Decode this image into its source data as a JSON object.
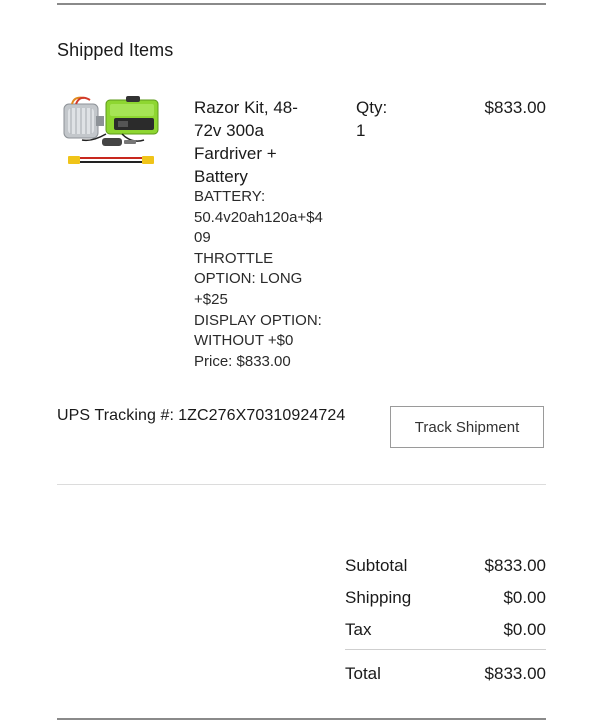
{
  "section_title": "Shipped Items",
  "item": {
    "image_alt": "Razor Kit product photo",
    "name_lines": [
      "Razor Kit, 48-",
      "72v 300a",
      "Fardriver +",
      "Battery"
    ],
    "option_lines": [
      "BATTERY:",
      "50.4v20ah120a+$4",
      "09",
      "THROTTLE",
      "OPTION: LONG",
      "+$25",
      "DISPLAY OPTION:",
      "WITHOUT +$0",
      "Price: $833.00"
    ],
    "qty_label": "Qty:",
    "qty_value": "1",
    "line_price": "$833.00"
  },
  "tracking": {
    "label": "UPS Tracking #:",
    "number": "1ZC276X70310924724",
    "button_label": "Track Shipment"
  },
  "summary": {
    "subtotal_label": "Subtotal",
    "subtotal_value": "$833.00",
    "shipping_label": "Shipping",
    "shipping_value": "$0.00",
    "tax_label": "Tax",
    "tax_value": "$0.00",
    "total_label": "Total",
    "total_value": "$833.00"
  },
  "colors": {
    "battery_green": "#8ed631",
    "motor_silver": "#b8bcc0",
    "wire_red": "#c8281e",
    "connector_yellow": "#f0c419"
  }
}
